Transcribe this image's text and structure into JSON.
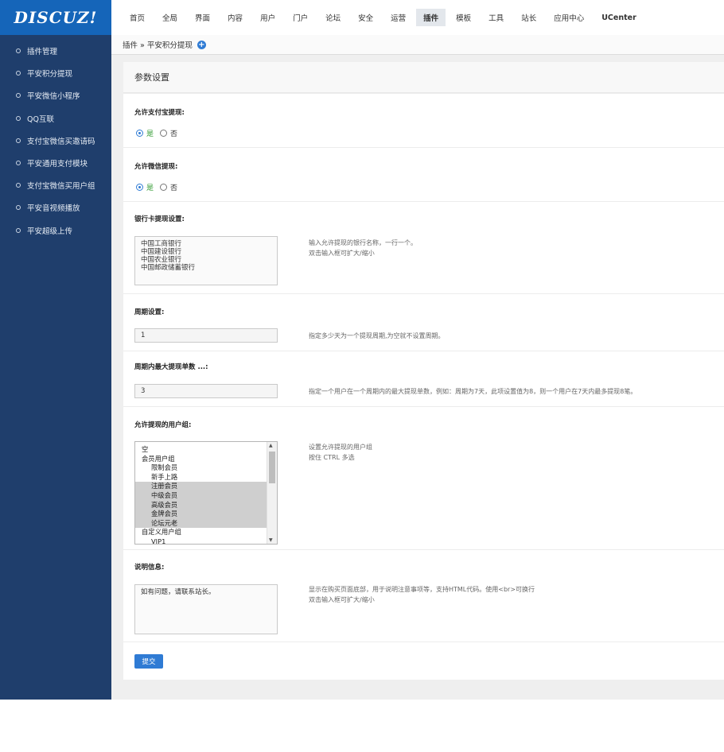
{
  "logo": "DISCUZ!",
  "sidebar": {
    "items": [
      {
        "label": "插件管理"
      },
      {
        "label": "平安积分提现"
      },
      {
        "label": "平安微信小程序"
      },
      {
        "label": "QQ互联"
      },
      {
        "label": "支付宝微信买邀请码"
      },
      {
        "label": "平安通用支付模块"
      },
      {
        "label": "支付宝微信买用户组"
      },
      {
        "label": "平安音视频播放"
      },
      {
        "label": "平安超级上传"
      }
    ]
  },
  "topnav": {
    "items": [
      {
        "label": "首页"
      },
      {
        "label": "全局"
      },
      {
        "label": "界面"
      },
      {
        "label": "内容"
      },
      {
        "label": "用户"
      },
      {
        "label": "门户"
      },
      {
        "label": "论坛"
      },
      {
        "label": "安全"
      },
      {
        "label": "运营"
      },
      {
        "label": "插件"
      },
      {
        "label": "模板"
      },
      {
        "label": "工具"
      },
      {
        "label": "站长"
      },
      {
        "label": "应用中心"
      },
      {
        "label": "UCenter"
      }
    ],
    "active": "插件"
  },
  "breadcrumb": "插件 » 平安积分提现",
  "panel_title": "参数设置",
  "form": {
    "alipay": {
      "label": "允许支付宝提现:",
      "yes": "是",
      "no": "否",
      "value": "是"
    },
    "wechat": {
      "label": "允许微信提现:",
      "yes": "是",
      "no": "否",
      "value": "是"
    },
    "bank": {
      "label": "银行卡提现设置:",
      "value": "中国工商银行\n中国建设银行\n中国农业银行\n中国邮政储蓄银行",
      "hint1": "输入允许提现的银行名称，一行一个。",
      "hint2": "双击输入框可扩大/缩小"
    },
    "period": {
      "label": "周期设置:",
      "value": "1",
      "hint": "指定多少天为一个提现周期,为空就不设置周期。"
    },
    "max_count": {
      "label": "周期内最大提现单数 ...:",
      "value": "3",
      "hint": "指定一个用户在一个周期内的最大提现单数，例如：周期为7天，此项设置值为8，则一个用户在7天内最多提现8笔。"
    },
    "groups": {
      "label": "允许提现的用户组:",
      "options": [
        {
          "label": "空",
          "indent": false,
          "selected": false
        },
        {
          "label": "会员用户组",
          "indent": false,
          "selected": false
        },
        {
          "label": "限制会员",
          "indent": true,
          "selected": false
        },
        {
          "label": "新手上路",
          "indent": true,
          "selected": false
        },
        {
          "label": "注册会员",
          "indent": true,
          "selected": true
        },
        {
          "label": "中级会员",
          "indent": true,
          "selected": true
        },
        {
          "label": "高级会员",
          "indent": true,
          "selected": true
        },
        {
          "label": "金牌会员",
          "indent": true,
          "selected": true
        },
        {
          "label": "论坛元老",
          "indent": true,
          "selected": true
        },
        {
          "label": "自定义用户组",
          "indent": false,
          "selected": false
        },
        {
          "label": "VIP1",
          "indent": true,
          "selected": false
        }
      ],
      "hint1": "设置允许提现的用户组",
      "hint2": "按住 CTRL 多选"
    },
    "notice": {
      "label": "说明信息:",
      "value": "如有问题，请联系站长。",
      "hint1": "显示在购买页面底部，用于说明注意事项等，支持HTML代码。使用<br>可换行",
      "hint2": "双击输入框可扩大/缩小"
    },
    "submit": "提交"
  }
}
